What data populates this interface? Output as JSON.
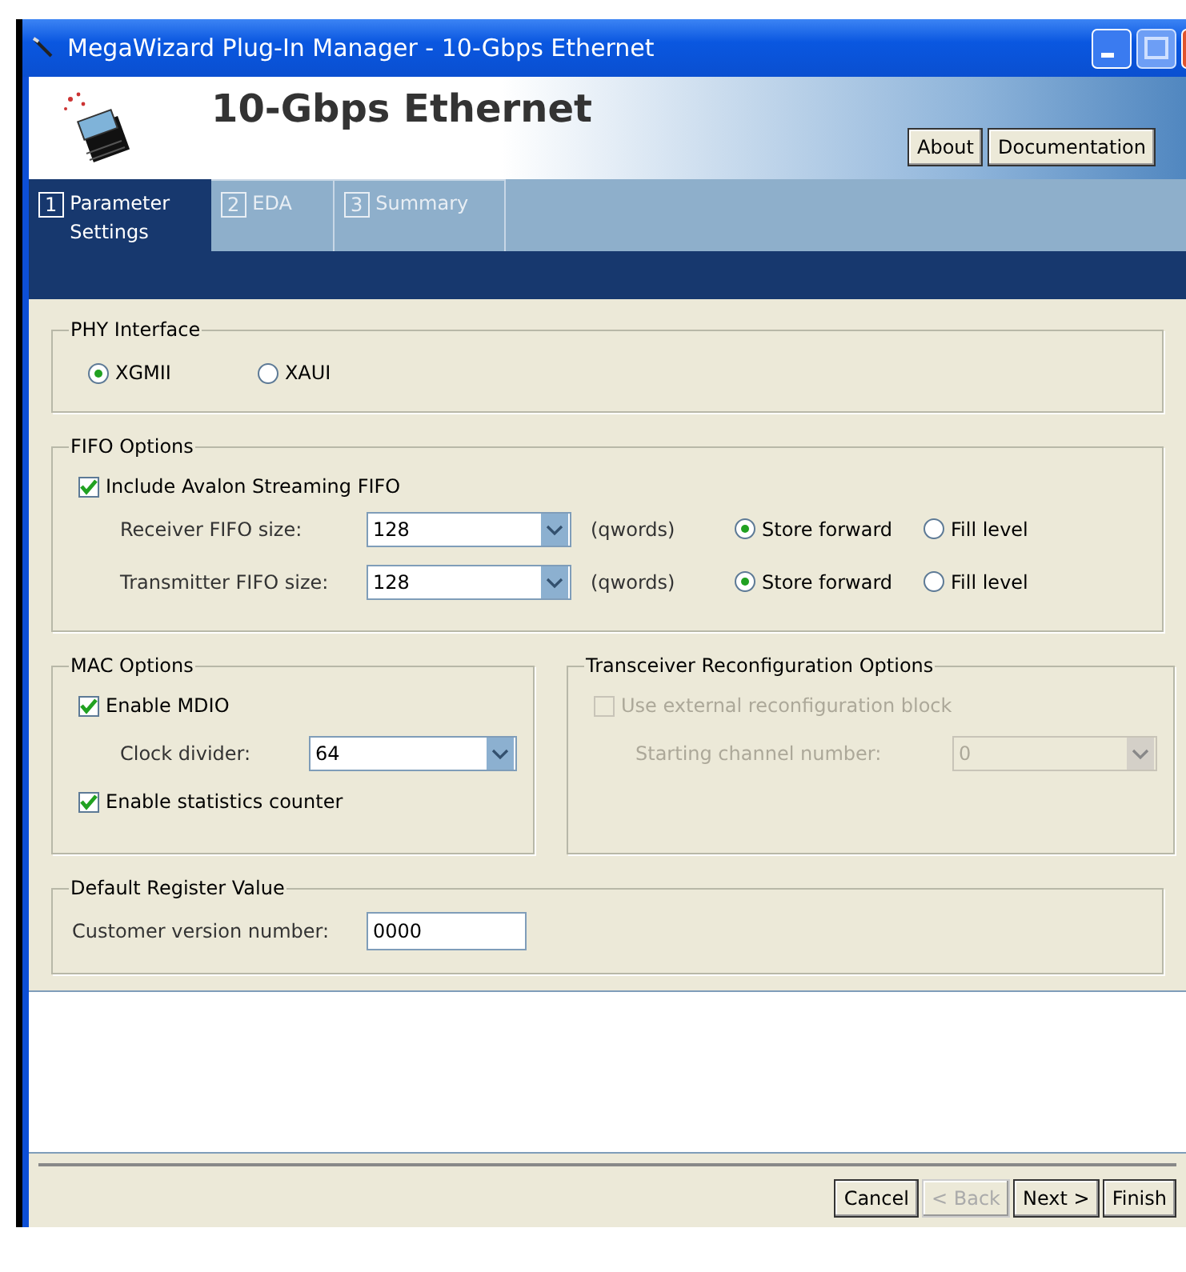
{
  "window": {
    "title": "MegaWizard Plug-In Manager - 10-Gbps Ethernet"
  },
  "header": {
    "title": "10-Gbps Ethernet",
    "buttons": [
      "About",
      "Documentation"
    ]
  },
  "tabs": [
    {
      "number": "1",
      "label": "Parameter Settings",
      "selected": true
    },
    {
      "number": "2",
      "label": "EDA",
      "selected": false
    },
    {
      "number": "3",
      "label": "Summary",
      "selected": false
    }
  ],
  "phy_interface": {
    "title": "PHY Interface",
    "options": [
      {
        "label": "XGMII",
        "selected": true
      },
      {
        "label": "XAUI",
        "selected": false
      }
    ]
  },
  "fifo_options": {
    "title": "FIFO Options",
    "include": {
      "label": "Include Avalon Streaming FIFO",
      "checked": true
    },
    "rows": [
      {
        "label": "Receiver FIFO size:",
        "value": "128",
        "unit": "(qwords)",
        "modes": [
          {
            "label": "Store forward",
            "selected": true
          },
          {
            "label": "Fill level",
            "selected": false
          }
        ]
      },
      {
        "label": "Transmitter FIFO size:",
        "value": "128",
        "unit": "(qwords)",
        "modes": [
          {
            "label": "Store forward",
            "selected": true
          },
          {
            "label": "Fill level",
            "selected": false
          }
        ]
      }
    ]
  },
  "mac_options": {
    "title": "MAC Options",
    "mdio": {
      "label": "Enable MDIO",
      "checked": true
    },
    "clock": {
      "label": "Clock divider:",
      "value": "64"
    },
    "stats": {
      "label": "Enable statistics counter",
      "checked": true
    }
  },
  "transceiver": {
    "title": "Transceiver Reconfiguration Options",
    "disabled": true,
    "external": {
      "label": "Use external reconfiguration block",
      "checked": false
    },
    "channel": {
      "label": "Starting channel number:",
      "value": "0"
    }
  },
  "default_register": {
    "title": "Default Register Value",
    "field": {
      "label": "Customer version number:",
      "value": "0000"
    }
  },
  "buttons": [
    {
      "label": "Cancel",
      "disabled": false
    },
    {
      "label": "< Back",
      "disabled": true
    },
    {
      "label": "Next >",
      "disabled": false
    },
    {
      "label": "Finish",
      "disabled": false
    }
  ]
}
